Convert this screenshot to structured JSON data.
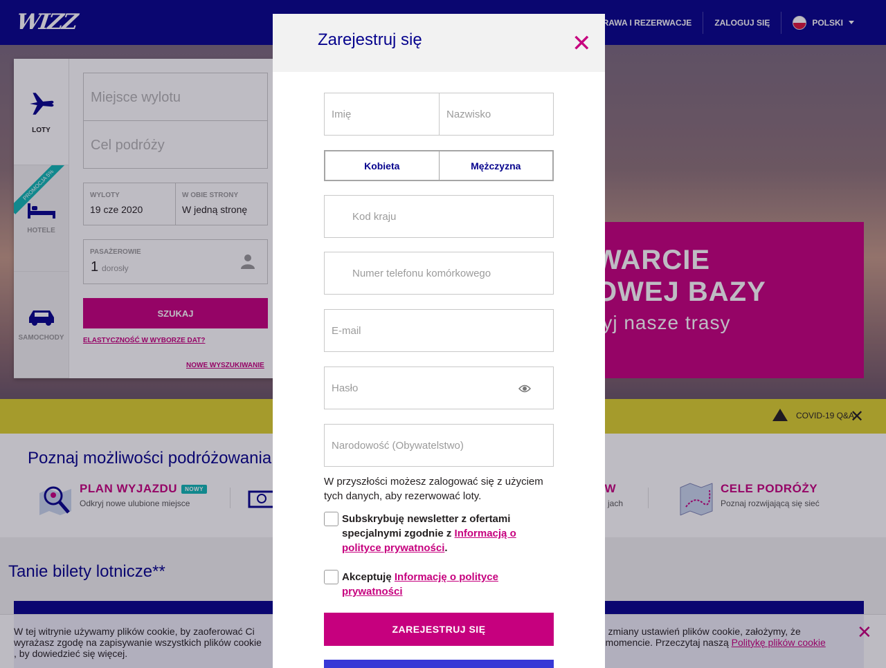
{
  "header": {
    "logo": "WIZZ",
    "nav": {
      "check_in": "ODPRAWA I REZERWACJE",
      "login": "ZALOGUJ SIĘ",
      "language": "POLSKI"
    }
  },
  "search_panel": {
    "tabs": {
      "flights": "LOTY",
      "hotels": "HOTELE",
      "cars": "SAMOCHODY",
      "promo_ribbon": "PROMOCJA 5%"
    },
    "departure_placeholder": "Miejsce wylotu",
    "destination_placeholder": "Cel podróży",
    "departures_label": "WYLOTY",
    "departures_value": "19 cze 2020",
    "trip_type_label": "W OBIE STRONY",
    "trip_type_value": "W jedną stronę",
    "passengers_label": "PASAŻEROWIE",
    "passengers_count": "1",
    "passengers_type": "dorosły",
    "search_button": "SZUKAJ",
    "flexible_dates_link": "ELASTYCZNOŚĆ W WYBORZE DAT?",
    "new_search_link": "NOWE WYSZUKIWANIE"
  },
  "hero": {
    "banner_line1": "WARCIE",
    "banner_line2": "OWEJ BAZY",
    "banner_line3": "ryj nasze trasy"
  },
  "covid_bar": {
    "text": "COVID-19 Q&A"
  },
  "explore": {
    "title": "Poznaj możliwości podróżowania",
    "features": [
      {
        "title": "PLAN WYJAZDU",
        "badge": "NOWY",
        "subtitle": "Odkryj nowe ulubione miejsce"
      },
      {
        "title": "W",
        "subtitle": "jach"
      },
      {
        "title": "CELE PODRÓŻY",
        "subtitle": "Poznaj rozwijającą się sieć"
      }
    ]
  },
  "cheap_tickets": {
    "title": "Tanie bilety lotnicze**"
  },
  "cookie": {
    "text_left": "W tej witrynie używamy plików cookie, by zaoferować Ci",
    "text_right": "bez zmiany ustawień plików cookie, założymy, że",
    "text2_left": "wyrażasz zgodę na zapisywanie wszystkich plików cookie",
    "text2_right": "ym momencie. Przeczytaj naszą",
    "policy_link": "Politykę plików cookie",
    "text3": ", by dowiedzieć się więcej."
  },
  "modal": {
    "title": "Zarejestruj się",
    "first_name_placeholder": "Imię",
    "last_name_placeholder": "Nazwisko",
    "gender_female": "Kobieta",
    "gender_male": "Mężczyzna",
    "country_code_placeholder": "Kod kraju",
    "phone_placeholder": "Numer telefonu komórkowego",
    "email_placeholder": "E-mail",
    "password_placeholder": "Hasło",
    "nationality_placeholder": "Narodowość (Obywatelstwo)",
    "info_text": "W przyszłości możesz zalogować się z użyciem tych danych, aby rezerwować loty.",
    "newsletter_text": "Subskrybuję newsletter z ofertami specjalnymi zgodnie z",
    "newsletter_link": "Informacją o polityce prywatności",
    "accept_text": "Akceptuję",
    "accept_link": "Informację o polityce prywatności",
    "register_button": "ZAREJESTRUJ SIĘ"
  },
  "colors": {
    "brand_navy": "#06038d",
    "brand_magenta": "#c6007e",
    "covid_yellow": "#ddd22e"
  }
}
